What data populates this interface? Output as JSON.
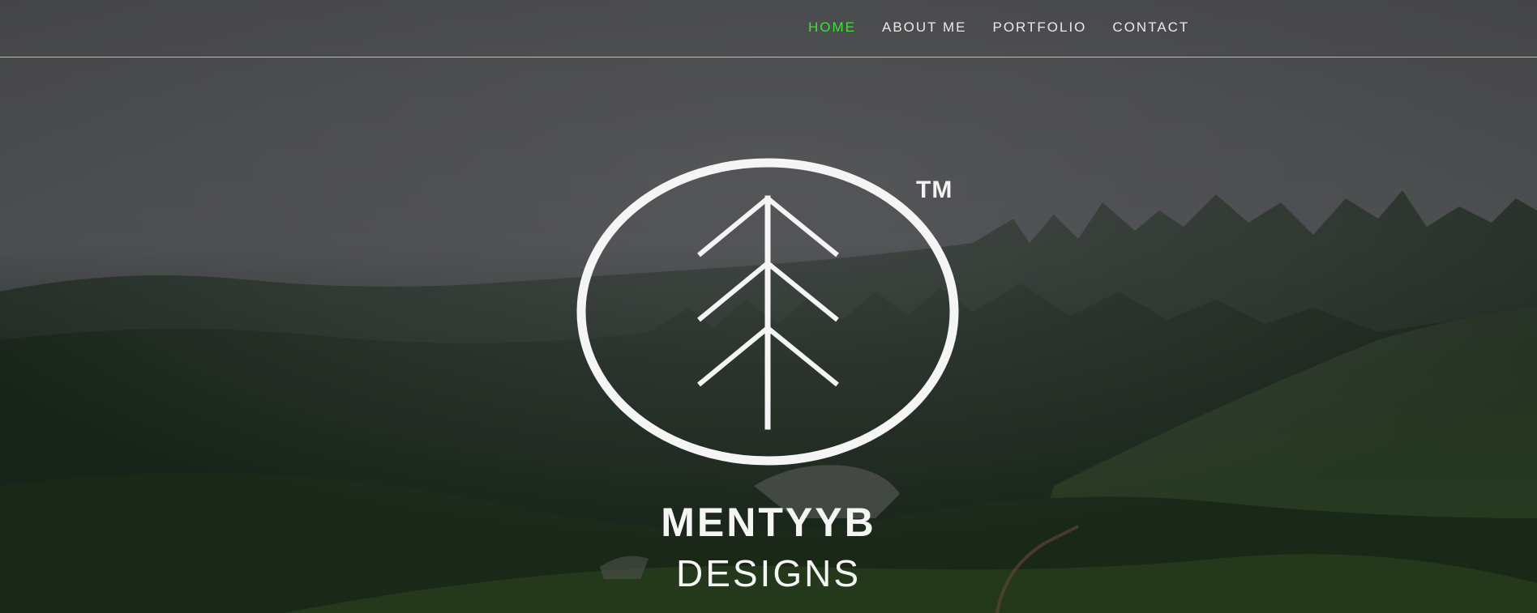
{
  "nav": {
    "items": [
      {
        "label": "HOME",
        "active": true
      },
      {
        "label": "ABOUT ME",
        "active": false
      },
      {
        "label": "PORTFOLIO",
        "active": false
      },
      {
        "label": "CONTACT",
        "active": false
      }
    ],
    "active_color": "#3ee03a",
    "text_color": "#eaeaea"
  },
  "logo": {
    "icon": "tree-in-circle-logo",
    "trademark": "TM"
  },
  "brand": {
    "title": "MENTYYB",
    "subtitle": "DESIGNS"
  },
  "background": {
    "icon": "misty-forest-hillside-photo"
  }
}
